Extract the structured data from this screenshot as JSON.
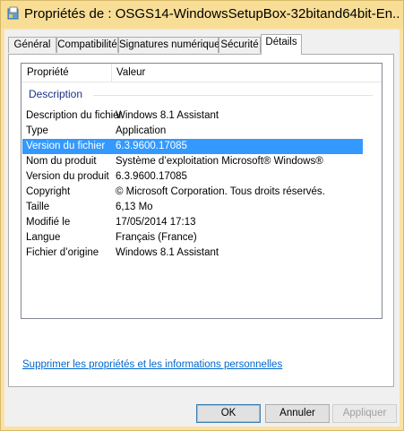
{
  "window": {
    "title": "Propriétés de : OSGS14-WindowsSetupBox-32bitand64bit-En...",
    "icon": "app-file-icon"
  },
  "tabs": [
    {
      "label": "Général",
      "active": false
    },
    {
      "label": "Compatibilité",
      "active": false
    },
    {
      "label": "Signatures numériques",
      "active": false
    },
    {
      "label": "Sécurité",
      "active": false
    },
    {
      "label": "Détails",
      "active": true
    }
  ],
  "details": {
    "columns": {
      "property": "Propriété",
      "value": "Valeur"
    },
    "group": "Description",
    "rows": [
      {
        "key": "Description du fichier",
        "value": "Windows 8.1 Assistant"
      },
      {
        "key": "Type",
        "value": "Application"
      },
      {
        "key": "Version du fichier",
        "value": "6.3.9600.17085",
        "selected": true
      },
      {
        "key": "Nom du produit",
        "value": "Système d’exploitation Microsoft® Windows®"
      },
      {
        "key": "Version du produit",
        "value": "6.3.9600.17085"
      },
      {
        "key": "Copyright",
        "value": "© Microsoft Corporation. Tous droits réservés."
      },
      {
        "key": "Taille",
        "value": "6,13 Mo"
      },
      {
        "key": "Modifié le",
        "value": "17/05/2014 17:13"
      },
      {
        "key": "Langue",
        "value": "Français (France)"
      },
      {
        "key": "Fichier d’origine",
        "value": "Windows 8.1 Assistant"
      }
    ]
  },
  "remove_link": "Supprimer les propriétés et les informations personnelles",
  "buttons": {
    "ok": "OK",
    "cancel": "Annuler",
    "apply": "Appliquer"
  },
  "colors": {
    "selection": "#3399ff",
    "link": "#0066cc",
    "title_bar": "#f7dd95"
  }
}
